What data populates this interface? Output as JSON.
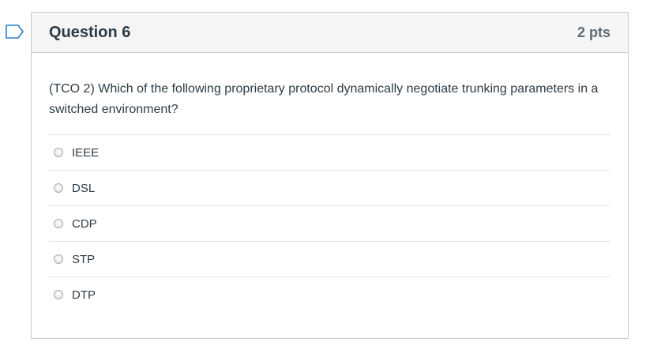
{
  "question": {
    "title": "Question 6",
    "points": "2 pts",
    "text": "(TCO 2) Which of the following proprietary protocol dynamically negotiate trunking parameters in a switched environment?",
    "answers": [
      {
        "label": "IEEE",
        "selected": false
      },
      {
        "label": "DSL",
        "selected": false
      },
      {
        "label": "CDP",
        "selected": false
      },
      {
        "label": "STP",
        "selected": false
      },
      {
        "label": "DTP",
        "selected": false
      }
    ]
  },
  "icons": {
    "flag": "bookmark-flag-icon"
  },
  "colors": {
    "accent": "#2d7dc9",
    "header_bg": "#f5f5f5",
    "border": "#c7cdd1",
    "text": "#2d3b45"
  }
}
